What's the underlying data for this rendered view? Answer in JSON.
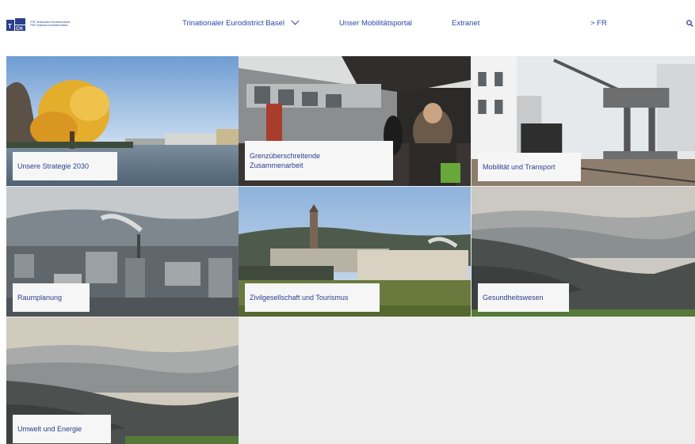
{
  "header": {
    "logo_initials_top": "T",
    "logo_initials_bottom": "CH",
    "logo_line1": "ETB Trinationaler Eurodistrict Basel",
    "logo_line2": "TEB Trinational Eurodistrict Basel",
    "nav": [
      {
        "label": "Trinationaler Eurodistrict Basel",
        "has_dropdown": true,
        "icon": "chevron-down-icon"
      },
      {
        "label": "Unser Mobilitätsportal"
      },
      {
        "label": "Extranet"
      },
      {
        "label": "> FR"
      }
    ],
    "search_icon": "search-icon"
  },
  "tiles": [
    {
      "label": "Unsere Strategie 2030"
    },
    {
      "label": "Grenzüberschreitende Zusammenarbeit"
    },
    {
      "label": "Mobilität und Transport"
    },
    {
      "label": "Raumplanung"
    },
    {
      "label": "Zivilgesellschaft und Tourismus"
    },
    {
      "label": "Gesundheitswesen"
    },
    {
      "label": "Umwelt und Energie"
    }
  ],
  "colors": {
    "brand": "#2b47a8",
    "label_bg": "#f6f6f6",
    "grid_bg": "#ededed"
  }
}
